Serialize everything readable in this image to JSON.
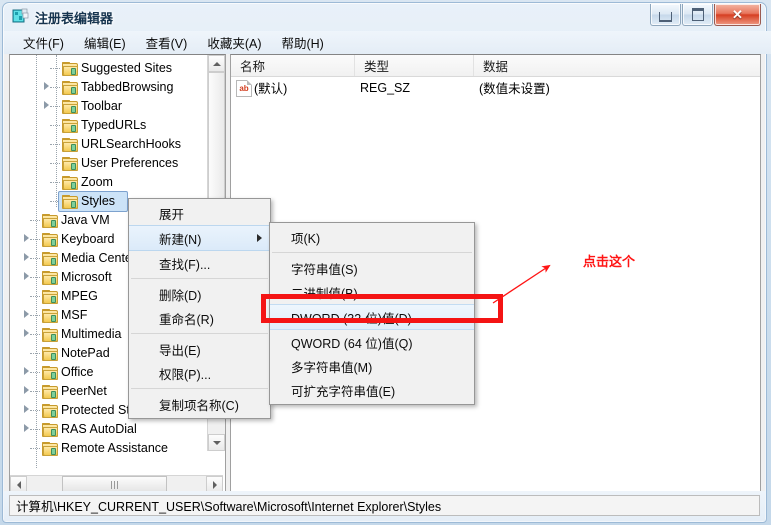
{
  "window": {
    "title": "注册表编辑器",
    "icon": "regedit-icon",
    "controls": {
      "minimize": "最小化",
      "maximize": "最大化",
      "close": "关闭"
    }
  },
  "menubar": {
    "items": [
      {
        "label": "文件(F)",
        "name": "menu-file"
      },
      {
        "label": "编辑(E)",
        "name": "menu-edit"
      },
      {
        "label": "查看(V)",
        "name": "menu-view"
      },
      {
        "label": "收藏夹(A)",
        "name": "menu-favorites"
      },
      {
        "label": "帮助(H)",
        "name": "menu-help"
      }
    ]
  },
  "tree": {
    "nodes": [
      {
        "label": "Suggested Sites",
        "indent": 2,
        "expander": false,
        "selected": false
      },
      {
        "label": "TabbedBrowsing",
        "indent": 2,
        "expander": true,
        "selected": false
      },
      {
        "label": "Toolbar",
        "indent": 2,
        "expander": true,
        "selected": false
      },
      {
        "label": "TypedURLs",
        "indent": 2,
        "expander": false,
        "selected": false
      },
      {
        "label": "URLSearchHooks",
        "indent": 2,
        "expander": false,
        "selected": false
      },
      {
        "label": "User Preferences",
        "indent": 2,
        "expander": false,
        "selected": false
      },
      {
        "label": "Zoom",
        "indent": 2,
        "expander": false,
        "selected": false
      },
      {
        "label": "Styles",
        "indent": 2,
        "expander": false,
        "selected": true
      },
      {
        "label": "Java VM",
        "indent": 1,
        "expander": false,
        "selected": false
      },
      {
        "label": "Keyboard",
        "indent": 1,
        "expander": true,
        "selected": false
      },
      {
        "label": "Media Center",
        "indent": 1,
        "expander": true,
        "selected": false
      },
      {
        "label": "Microsoft",
        "indent": 1,
        "expander": true,
        "selected": false
      },
      {
        "label": "MPEG",
        "indent": 1,
        "expander": false,
        "selected": false
      },
      {
        "label": "MSF",
        "indent": 1,
        "expander": true,
        "selected": false
      },
      {
        "label": "Multimedia",
        "indent": 1,
        "expander": true,
        "selected": false
      },
      {
        "label": "NotePad",
        "indent": 1,
        "expander": false,
        "selected": false
      },
      {
        "label": "Office",
        "indent": 1,
        "expander": true,
        "selected": false
      },
      {
        "label": "PeerNet",
        "indent": 1,
        "expander": true,
        "selected": false
      },
      {
        "label": "Protected Storage System",
        "indent": 1,
        "expander": true,
        "selected": false
      },
      {
        "label": "RAS AutoDial",
        "indent": 1,
        "expander": true,
        "selected": false
      },
      {
        "label": "Remote Assistance",
        "indent": 1,
        "expander": false,
        "selected": false
      }
    ]
  },
  "list": {
    "columns": [
      {
        "label": "名称",
        "name": "column-name"
      },
      {
        "label": "类型",
        "name": "column-type"
      },
      {
        "label": "数据",
        "name": "column-data"
      }
    ],
    "rows": [
      {
        "icon": "ab-string-icon",
        "icon_text": "ab",
        "name": "(默认)",
        "type": "REG_SZ",
        "data": "(数值未设置)"
      }
    ]
  },
  "context_menu": {
    "items": [
      {
        "label": "展开",
        "name": "ctx-expand",
        "highlighted": false,
        "submenu": false
      },
      {
        "label": "新建(N)",
        "name": "ctx-new",
        "highlighted": true,
        "submenu": true
      },
      {
        "label": "查找(F)...",
        "name": "ctx-find",
        "highlighted": false,
        "submenu": false
      },
      {
        "separator": true
      },
      {
        "label": "删除(D)",
        "name": "ctx-delete",
        "highlighted": false,
        "submenu": false
      },
      {
        "label": "重命名(R)",
        "name": "ctx-rename",
        "highlighted": false,
        "submenu": false
      },
      {
        "separator": true
      },
      {
        "label": "导出(E)",
        "name": "ctx-export",
        "highlighted": false,
        "submenu": false
      },
      {
        "label": "权限(P)...",
        "name": "ctx-permissions",
        "highlighted": false,
        "submenu": false
      },
      {
        "separator": true
      },
      {
        "label": "复制项名称(C)",
        "name": "ctx-copy-key-name",
        "highlighted": false,
        "submenu": false
      }
    ]
  },
  "submenu": {
    "items": [
      {
        "label": "项(K)",
        "name": "sub-key",
        "highlighted": false
      },
      {
        "separator": true
      },
      {
        "label": "字符串值(S)",
        "name": "sub-string-value",
        "highlighted": false
      },
      {
        "label": "二进制值(B)",
        "name": "sub-binary-value",
        "highlighted": false
      },
      {
        "label": "DWORD (32-位)值(D)",
        "name": "sub-dword-value",
        "highlighted": true
      },
      {
        "label": "QWORD (64 位)值(Q)",
        "name": "sub-qword-value",
        "highlighted": false
      },
      {
        "label": "多字符串值(M)",
        "name": "sub-multi-string-value",
        "highlighted": false
      },
      {
        "label": "可扩充字符串值(E)",
        "name": "sub-expandable-string-value",
        "highlighted": false
      }
    ]
  },
  "annotation": {
    "text": "点击这个",
    "color": "#ff1414",
    "highlight_color": "#f41414"
  },
  "statusbar": {
    "path": "计算机\\HKEY_CURRENT_USER\\Software\\Microsoft\\Internet Explorer\\Styles"
  }
}
